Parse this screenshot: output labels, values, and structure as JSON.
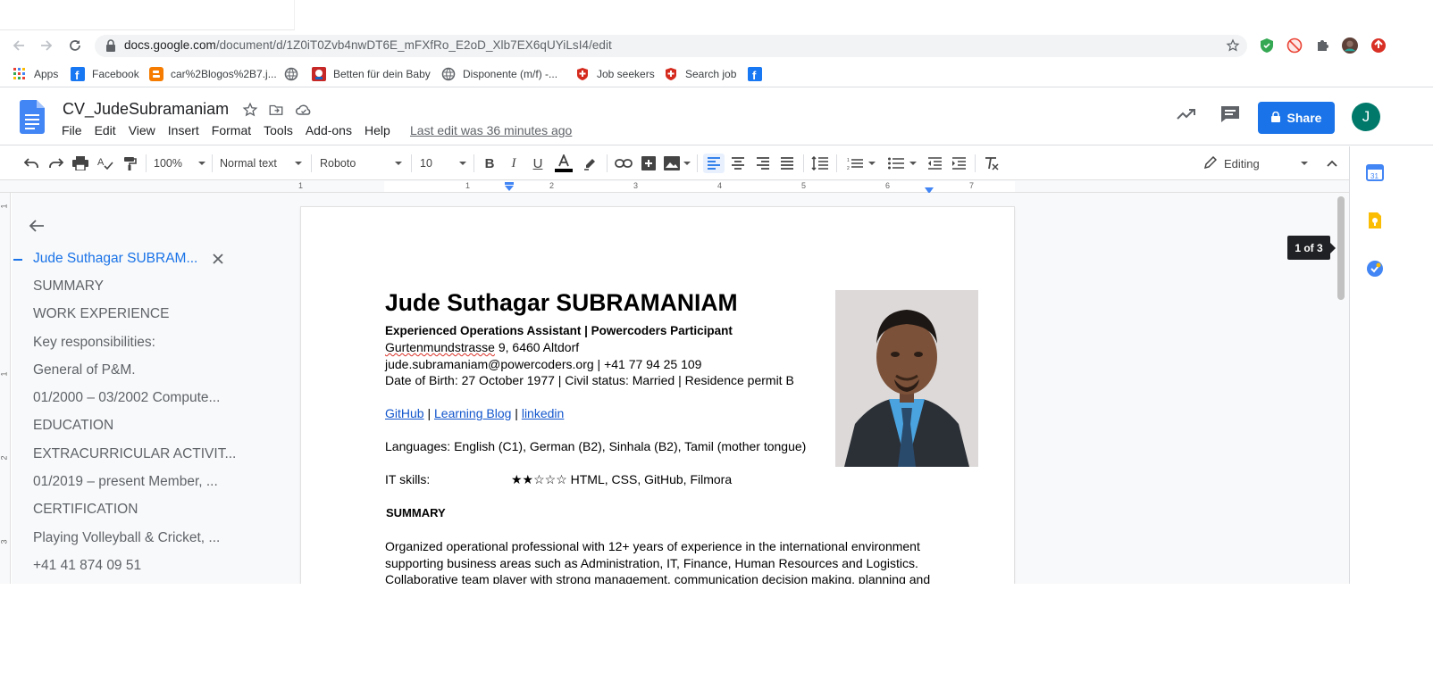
{
  "browser": {
    "url_host": "docs.google.com",
    "url_path": "/document/d/1Z0iT0Zvb4nwDT6E_mFXfRo_E2oD_Xlb7EX6qUYiLsI4/edit"
  },
  "bookmarks": [
    {
      "label": "Apps",
      "icon": "apps-grid-icon"
    },
    {
      "label": "Facebook",
      "icon": "facebook-icon"
    },
    {
      "label": "car%2Blogos%2B7.j...",
      "icon": "blogger-icon"
    },
    {
      "label": "",
      "icon": "globe-icon"
    },
    {
      "label": "Betten für dein Baby",
      "icon": "baby-shop-icon"
    },
    {
      "label": "Disponente (m/f) -...",
      "icon": "globe-icon"
    },
    {
      "label": "Job seekers",
      "icon": "swiss-shield-icon"
    },
    {
      "label": "Search job",
      "icon": "swiss-shield-icon"
    },
    {
      "label": "",
      "icon": "facebook-icon"
    }
  ],
  "docs": {
    "title": "CV_JudeSubramaniam",
    "menu": [
      "File",
      "Edit",
      "View",
      "Insert",
      "Format",
      "Tools",
      "Add-ons",
      "Help"
    ],
    "last_edit": "Last edit was 36 minutes ago",
    "share_label": "Share",
    "avatar_initial": "J"
  },
  "toolbar": {
    "zoom": "100%",
    "style": "Normal text",
    "font": "Roboto",
    "size": "10",
    "mode": "Editing"
  },
  "ruler": [
    "1",
    "1",
    "2",
    "3",
    "4",
    "5",
    "6",
    "7"
  ],
  "vruler": [
    "1",
    "1",
    "2",
    "3"
  ],
  "outline": [
    "Jude Suthagar SUBRAM...",
    "SUMMARY",
    "WORK EXPERIENCE",
    "Key responsibilities:",
    "General of P&M.",
    "01/2000 – 03/2002 Compute...",
    "EDUCATION",
    "EXTRACURRICULAR ACTIVIT...",
    "01/2019 – present Member, ...",
    "CERTIFICATION",
    "Playing Volleyball & Cricket, ...",
    "+41 41 874 09 51"
  ],
  "document": {
    "name": "Jude Suthagar SUBRAMANIAM",
    "headline": "Experienced Operations Assistant | Powercoders Participant",
    "street": "Gurtenmundstrasse",
    "address_rest": " 9, 6460 Altdorf",
    "contact": "jude.subramaniam@powercoders.org | +41 77 94 25 109",
    "personal": "Date of Birth: 27 October 1977 | Civil status: Married | Residence permit B",
    "links": [
      "GitHub",
      "Learning Blog",
      "linkedin"
    ],
    "link_sep": " | ",
    "languages": "Languages: English (C1), German (B2), Sinhala (B2), Tamil (mother tongue)",
    "it_label": "IT skills:",
    "it_value": "★★☆☆☆ HTML, CSS, GitHub, Filmora",
    "summary_heading": "SUMMARY",
    "summary_lines": [
      "Organized operational professional with 12+ years of experience in the international environment",
      "supporting business areas such as Administration, IT, Finance, Human Resources and Logistics.",
      "Collaborative team player with strong management, communication decision making, planning and"
    ]
  },
  "page_indicator": "1 of 3",
  "colors": {
    "accent": "#1a73e8",
    "link": "#1155cc",
    "avatar": "#00796b",
    "docs_blue": "#4285f4"
  }
}
